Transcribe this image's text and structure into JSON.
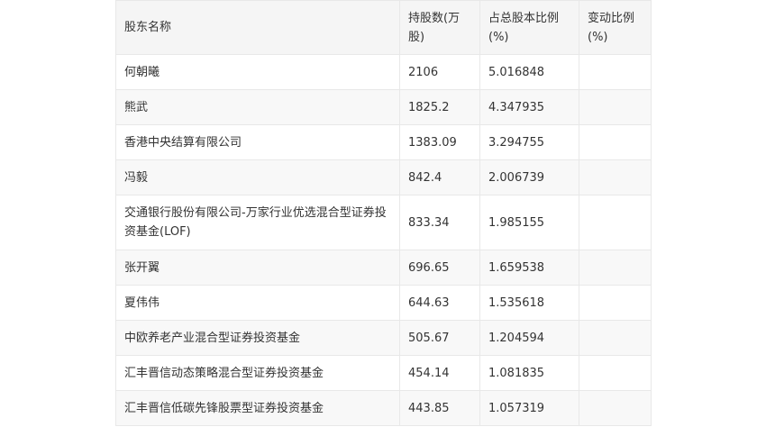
{
  "table": {
    "headers": [
      "股东名称",
      "持股数(万股)",
      "占总股本比例(%)",
      "变动比例(%)"
    ],
    "rows": [
      {
        "name": "何朝曦",
        "shares": "2106",
        "ratio": "5.016848",
        "change": ""
      },
      {
        "name": "熊武",
        "shares": "1825.2",
        "ratio": "4.347935",
        "change": ""
      },
      {
        "name": "香港中央结算有限公司",
        "shares": "1383.09",
        "ratio": "3.294755",
        "change": ""
      },
      {
        "name": "冯毅",
        "shares": "842.4",
        "ratio": "2.006739",
        "change": ""
      },
      {
        "name": "交通银行股份有限公司-万家行业优选混合型证券投资基金(LOF)",
        "shares": "833.34",
        "ratio": "1.985155",
        "change": ""
      },
      {
        "name": "张开翼",
        "shares": "696.65",
        "ratio": "1.659538",
        "change": ""
      },
      {
        "name": "夏伟伟",
        "shares": "644.63",
        "ratio": "1.535618",
        "change": ""
      },
      {
        "name": "中欧养老产业混合型证券投资基金",
        "shares": "505.67",
        "ratio": "1.204594",
        "change": ""
      },
      {
        "name": "汇丰晋信动态策略混合型证券投资基金",
        "shares": "454.14",
        "ratio": "1.081835",
        "change": ""
      },
      {
        "name": "汇丰晋信低碳先锋股票型证券投资基金",
        "shares": "443.85",
        "ratio": "1.057319",
        "change": ""
      }
    ]
  }
}
